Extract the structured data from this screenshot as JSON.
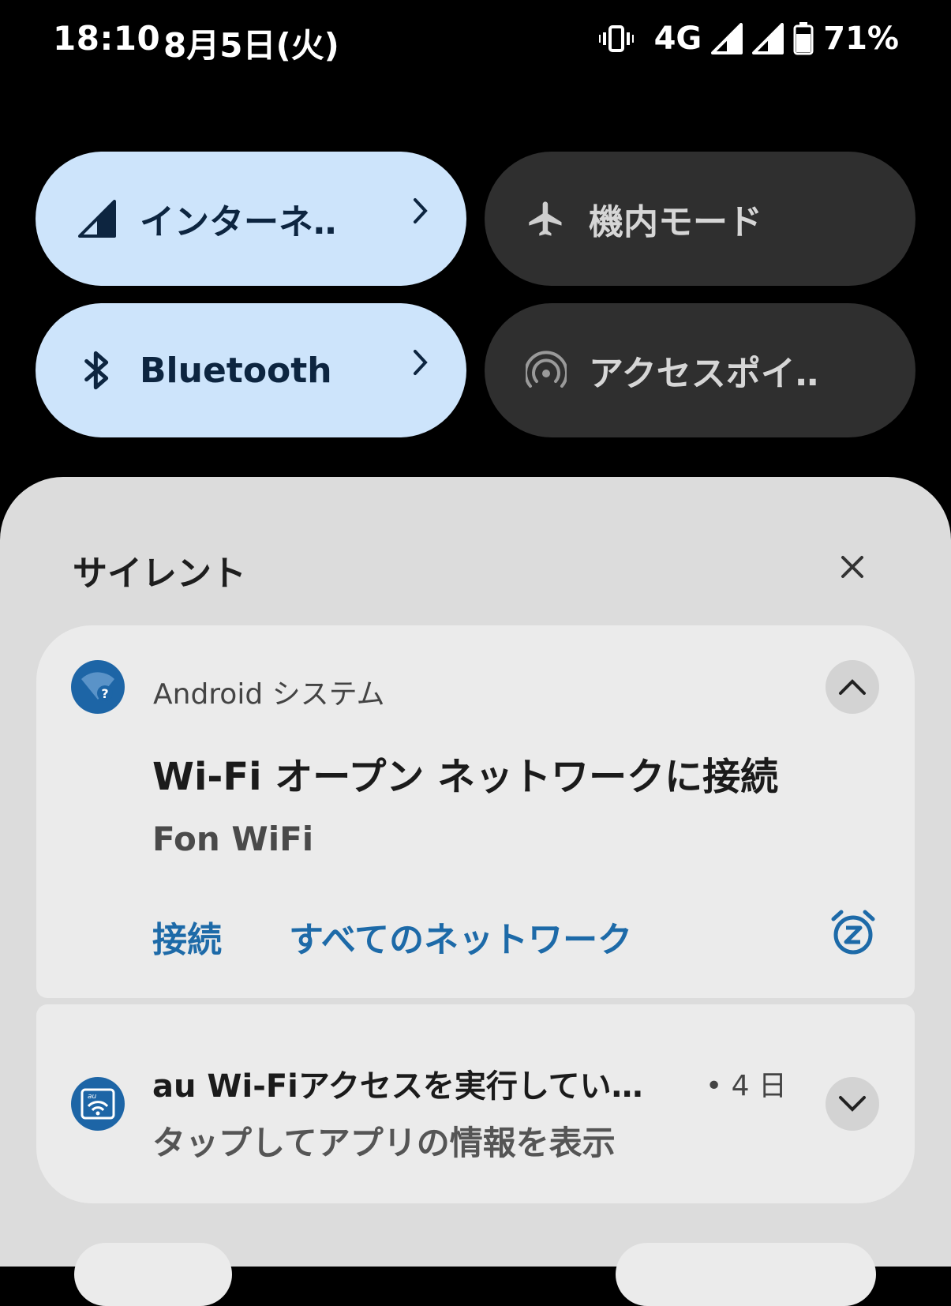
{
  "status_bar": {
    "time": "18:10",
    "date": "8月5日(火)",
    "network": "4G",
    "battery": "71%"
  },
  "tiles": [
    {
      "label": "インターネ‥",
      "icon": "cell-signal-icon",
      "state": "on"
    },
    {
      "label": "機内モード",
      "icon": "airplane-icon",
      "state": "off"
    },
    {
      "label": "Bluetooth",
      "icon": "bluetooth-icon",
      "state": "on"
    },
    {
      "label": "アクセスポイ‥",
      "icon": "hotspot-icon",
      "state": "off"
    }
  ],
  "section": {
    "title": "サイレント"
  },
  "notifications": [
    {
      "app": "Android システム",
      "title": "Wi-Fi オープン ネットワークに接続",
      "text": "Fon WiFi",
      "actions": [
        "接続",
        "すべてのネットワーク"
      ]
    },
    {
      "title": "au Wi-Fiアクセスを実行してい…",
      "time": "• 4 日",
      "text": "タップしてアプリの情報を表示"
    }
  ],
  "colors": {
    "tile_on": "#cde4fb",
    "tile_off": "#2f2f2f",
    "accent": "#1d6aa8",
    "shade": "#dcdcdc",
    "card": "#ebebeb"
  }
}
